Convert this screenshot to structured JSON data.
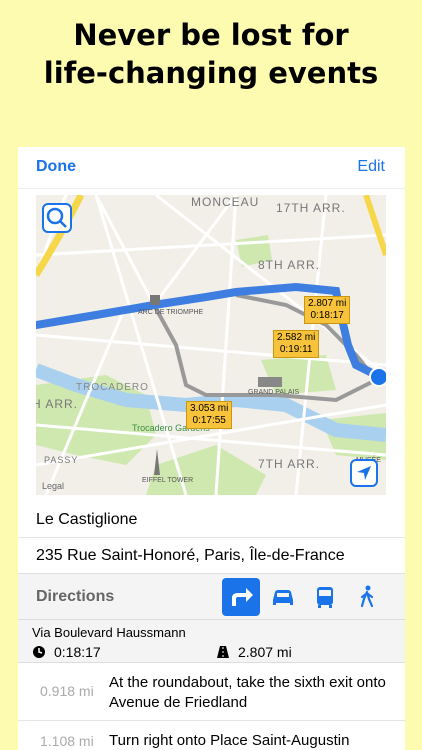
{
  "headline": {
    "line1": "Never be lost for",
    "line2": "life-changing events"
  },
  "navbar": {
    "done_label": "Done",
    "edit_label": "Edit"
  },
  "map": {
    "labels": {
      "monceau": "MONCEAU",
      "arr17": "17TH ARR.",
      "arr8": "8TH ARR.",
      "trocadero": "TROCADERO",
      "arr16": "H ARR.",
      "passy": "PASSY",
      "arr7": "7TH ARR.",
      "arc": "ARC DE TRIOMPHE",
      "grand_palais": "GRAND PALAIS",
      "eiffel": "EIFFEL TOWER",
      "gardens": "Trocadero Gardens",
      "musee": "MUSÉE",
      "legal": "Legal"
    },
    "routes": [
      {
        "distance": "2.807 mi",
        "time": "0:18:17"
      },
      {
        "distance": "2.582 mi",
        "time": "0:19:11"
      },
      {
        "distance": "3.053 mi",
        "time": "0:17:55"
      }
    ]
  },
  "place": {
    "name": "Le Castiglione",
    "address": "235 Rue Saint-Honoré, Paris, Île-de-France"
  },
  "directions": {
    "title": "Directions",
    "modes": [
      "directions-icon",
      "car-icon",
      "transit-icon",
      "walk-icon"
    ],
    "via": "Via Boulevard Haussmann",
    "duration": "0:18:17",
    "distance": "2.807 mi",
    "steps": [
      {
        "distance": "0.918 mi",
        "text": "At the roundabout, take the sixth exit onto Avenue de Friedland"
      },
      {
        "distance": "1.108 mi",
        "text": "Turn right onto Place Saint-Augustin"
      }
    ]
  },
  "colors": {
    "accent": "#1a73e8",
    "route_tag": "#f7c33a",
    "background": "#fdfbb0"
  }
}
